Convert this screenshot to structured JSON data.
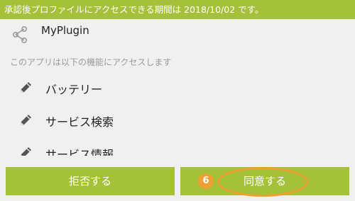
{
  "banner": {
    "text": "承認後プロファイルにアクセスできる期間は 2018/10/02 です。"
  },
  "app": {
    "name": "MyPlugin",
    "icon": "share-icon"
  },
  "description": "このアプリは以下の機能にアクセスします",
  "permissions": [
    {
      "label": "バッテリー",
      "icon": "pencil-icon"
    },
    {
      "label": "サービス検索",
      "icon": "pencil-icon"
    },
    {
      "label": "サービス情報",
      "icon": "pencil-icon"
    }
  ],
  "buttons": {
    "deny_label": "拒否する",
    "agree_label": "同意する"
  },
  "annotation": {
    "step": "6"
  },
  "colors": {
    "accent_green": "#a5c13a",
    "annotation_orange": "#f0a030"
  }
}
